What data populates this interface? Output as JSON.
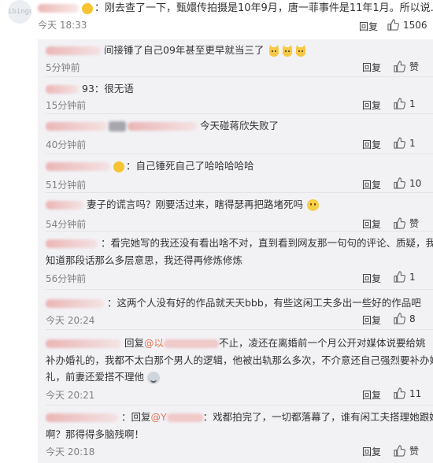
{
  "top_comment": {
    "avatar_text": "ibingo",
    "text": "：刚去查了一下，甄嬛传拍摄是10年9月，唐一菲事件是11年1月。所以说……",
    "time": "今天 18:33",
    "reply_label": "回复",
    "likes": "1506"
  },
  "replies": [
    {
      "text": "间接锤了自己09年甚至更早就当三了",
      "time": "5分钟前",
      "reply_label": "回复",
      "likes": "赞",
      "emojis": [
        "cat-emoji",
        "cat-emoji",
        "cat-emoji"
      ]
    },
    {
      "text": "93：很无语",
      "time": "15分钟前",
      "reply_label": "回复",
      "likes": "1"
    },
    {
      "text": "今天碰蒋欣失败了",
      "time": "40分钟前",
      "reply_label": "回复",
      "likes": "1"
    },
    {
      "text": "：自己锤死自己了哈哈哈哈哈",
      "time": "51分钟前",
      "reply_label": "回复",
      "likes": "10"
    },
    {
      "text": "妻子的谎言吗？刚要活过来，瞎得瑟再把路堵死吗",
      "time": "54分钟前",
      "reply_label": "回复",
      "likes": "赞",
      "emojis": [
        "smile-emoji"
      ]
    },
    {
      "text_line1": "：看完她写的我还没有看出啥不对，直到看到网友那一句句的评论、质疑，我才",
      "text_line2": "知道那段话那么多层意思，我还得再修炼修炼",
      "time": "56分钟前",
      "reply_label": "回复",
      "likes": "1"
    },
    {
      "text": "：这两个人没有好的作品就天天bbb，有些这闲工夫多出一些好的作品吧",
      "time": "今天 20:24",
      "reply_label": "回复",
      "likes": "8"
    },
    {
      "prefix": "回复",
      "mention": "@以",
      "text_line1_rest": "不止，凌还在离婚前一个月公开对媒体说要给姚",
      "text_line2": "补办婚礼的，我都不太白那个男人的逻辑，他被出轨那么多次，不介意还自己强烈要补办婚",
      "text_line3": "礼，前妻还爱搭不理他",
      "time": "今天 20:21",
      "reply_label": "回复",
      "likes": "11"
    },
    {
      "prefix": "：回复",
      "mention": "@Y",
      "text_line1_rest": "：戏都拍完了，一切都落幕了，谁有闲工夫搭理她跟她撕",
      "text_line2": "啊？那得得多脑残啊！",
      "time": "今天 20:18",
      "reply_label": "回复",
      "likes": "赞"
    }
  ],
  "colors": {
    "mention": "#eb7350",
    "meta": "#808080",
    "replies_bg": "#f2f2f5"
  },
  "icons": {
    "like": "thumbs-up-icon",
    "badge": "vip-badge-icon"
  }
}
